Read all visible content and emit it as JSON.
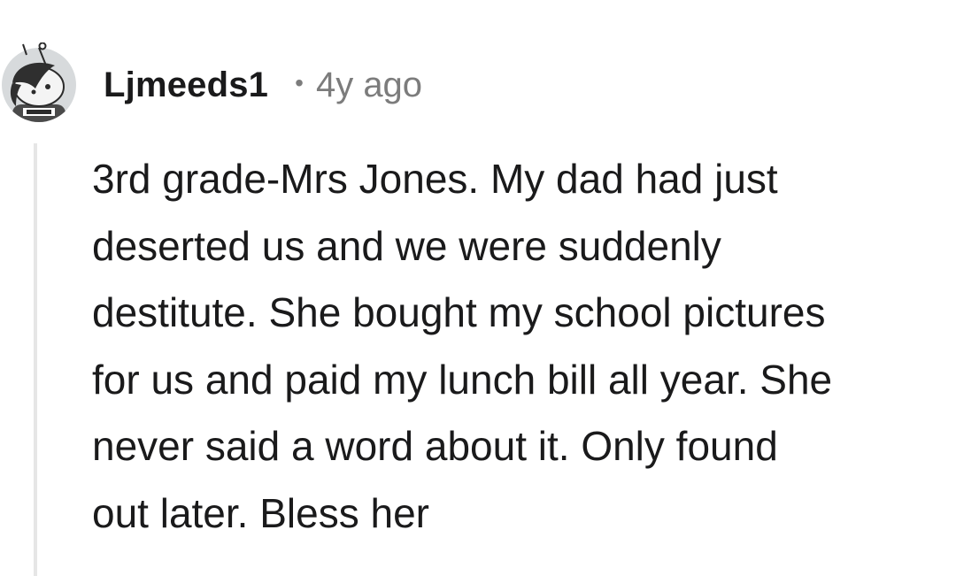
{
  "comment": {
    "author": "Ljmeeds1",
    "separator": "•",
    "age": "4y ago",
    "avatar_icon": "snoo-avatar-icon",
    "body_lines": [
      "3rd grade-Mrs Jones. My dad had just",
      "deserted us and we were suddenly",
      "destitute. She bought my school pictures",
      "for us and paid my lunch bill all year. She",
      "never said a word about it. Only found",
      "out later. Bless her"
    ]
  },
  "colors": {
    "text": "#1a1a1b",
    "meta": "#7c7c7c",
    "thread_line": "#e6e6e6",
    "avatar_bg": "#d7dadc"
  }
}
